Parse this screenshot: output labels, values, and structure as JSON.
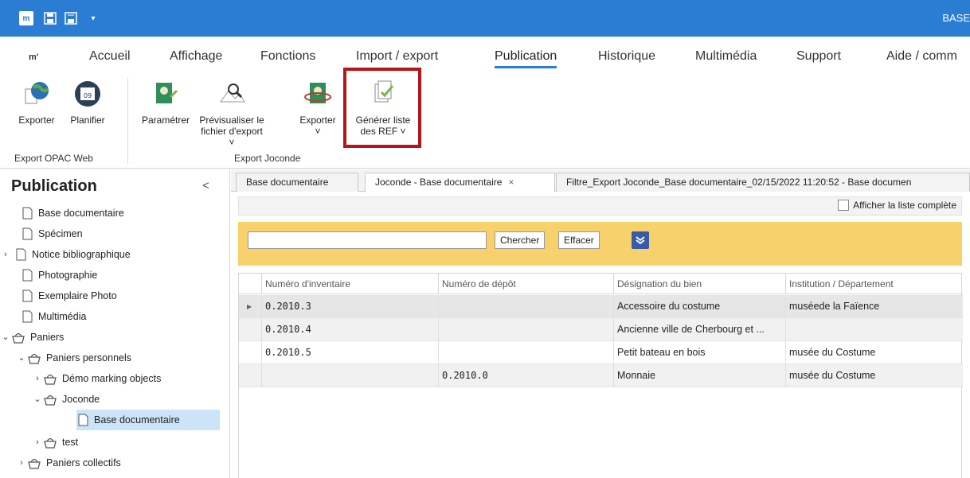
{
  "titlebar": {
    "logo": "m",
    "title": "BASE"
  },
  "ribbon_tabs": {
    "logo": "m'",
    "tabs": [
      "Accueil",
      "Affichage",
      "Fonctions",
      "Import / export",
      "Publication",
      "Historique",
      "Multimédia",
      "Support",
      "Aide / comm"
    ],
    "active": "Publication"
  },
  "ribbon": {
    "buttons": {
      "exporter1": "Exporter",
      "planifier": "Planifier",
      "parametrer": "Paramétrer",
      "previsualiser_l1": "Prévisualiser le",
      "previsualiser_l2": "fichier d'export",
      "exporter2": "Exporter",
      "generer_l1": "Générer liste",
      "generer_l2": "des REF"
    },
    "groups": {
      "opac": "Export OPAC Web",
      "joconde": "Export Joconde"
    }
  },
  "left_panel": {
    "title": "Publication",
    "items": [
      "Base documentaire",
      "Spécimen",
      "Notice bibliographique",
      "Photographie",
      "Exemplaire Photo",
      "Multimédia",
      "Paniers",
      "Paniers personnels",
      "Démo marking objects",
      "Joconde",
      "Base documentaire",
      "test",
      "Paniers collectifs"
    ]
  },
  "doc_tabs": {
    "tab1": "Base documentaire",
    "tab2": "Joconde - Base documentaire",
    "tab3": "Filtre_Export Joconde_Base documentaire_02/15/2022 11:20:52 - Base documen"
  },
  "topbar": {
    "show_full_list": "Afficher la liste complète"
  },
  "search": {
    "value": "",
    "search_button": "Chercher",
    "clear_button": "Effacer"
  },
  "grid": {
    "columns": [
      "Numéro d'inventaire",
      "Numéro de dépôt",
      "Désignation du bien",
      "Institution / Département"
    ],
    "rows": [
      [
        "0.2010.3",
        "",
        "Accessoire du costume",
        "muséede la Faïence"
      ],
      [
        "0.2010.4",
        "",
        "Ancienne ville de Cherbourg et ...",
        ""
      ],
      [
        "0.2010.5",
        "",
        "Petit bateau en bois",
        "musée du Costume"
      ],
      [
        "",
        "0.2010.0",
        "Monnaie",
        "musée du Costume"
      ]
    ]
  },
  "colors": {
    "titlebar": "#2b7cd3",
    "highlight": "#b8141b",
    "searchbar": "#f7d16b",
    "selection": "#cce4f7"
  }
}
